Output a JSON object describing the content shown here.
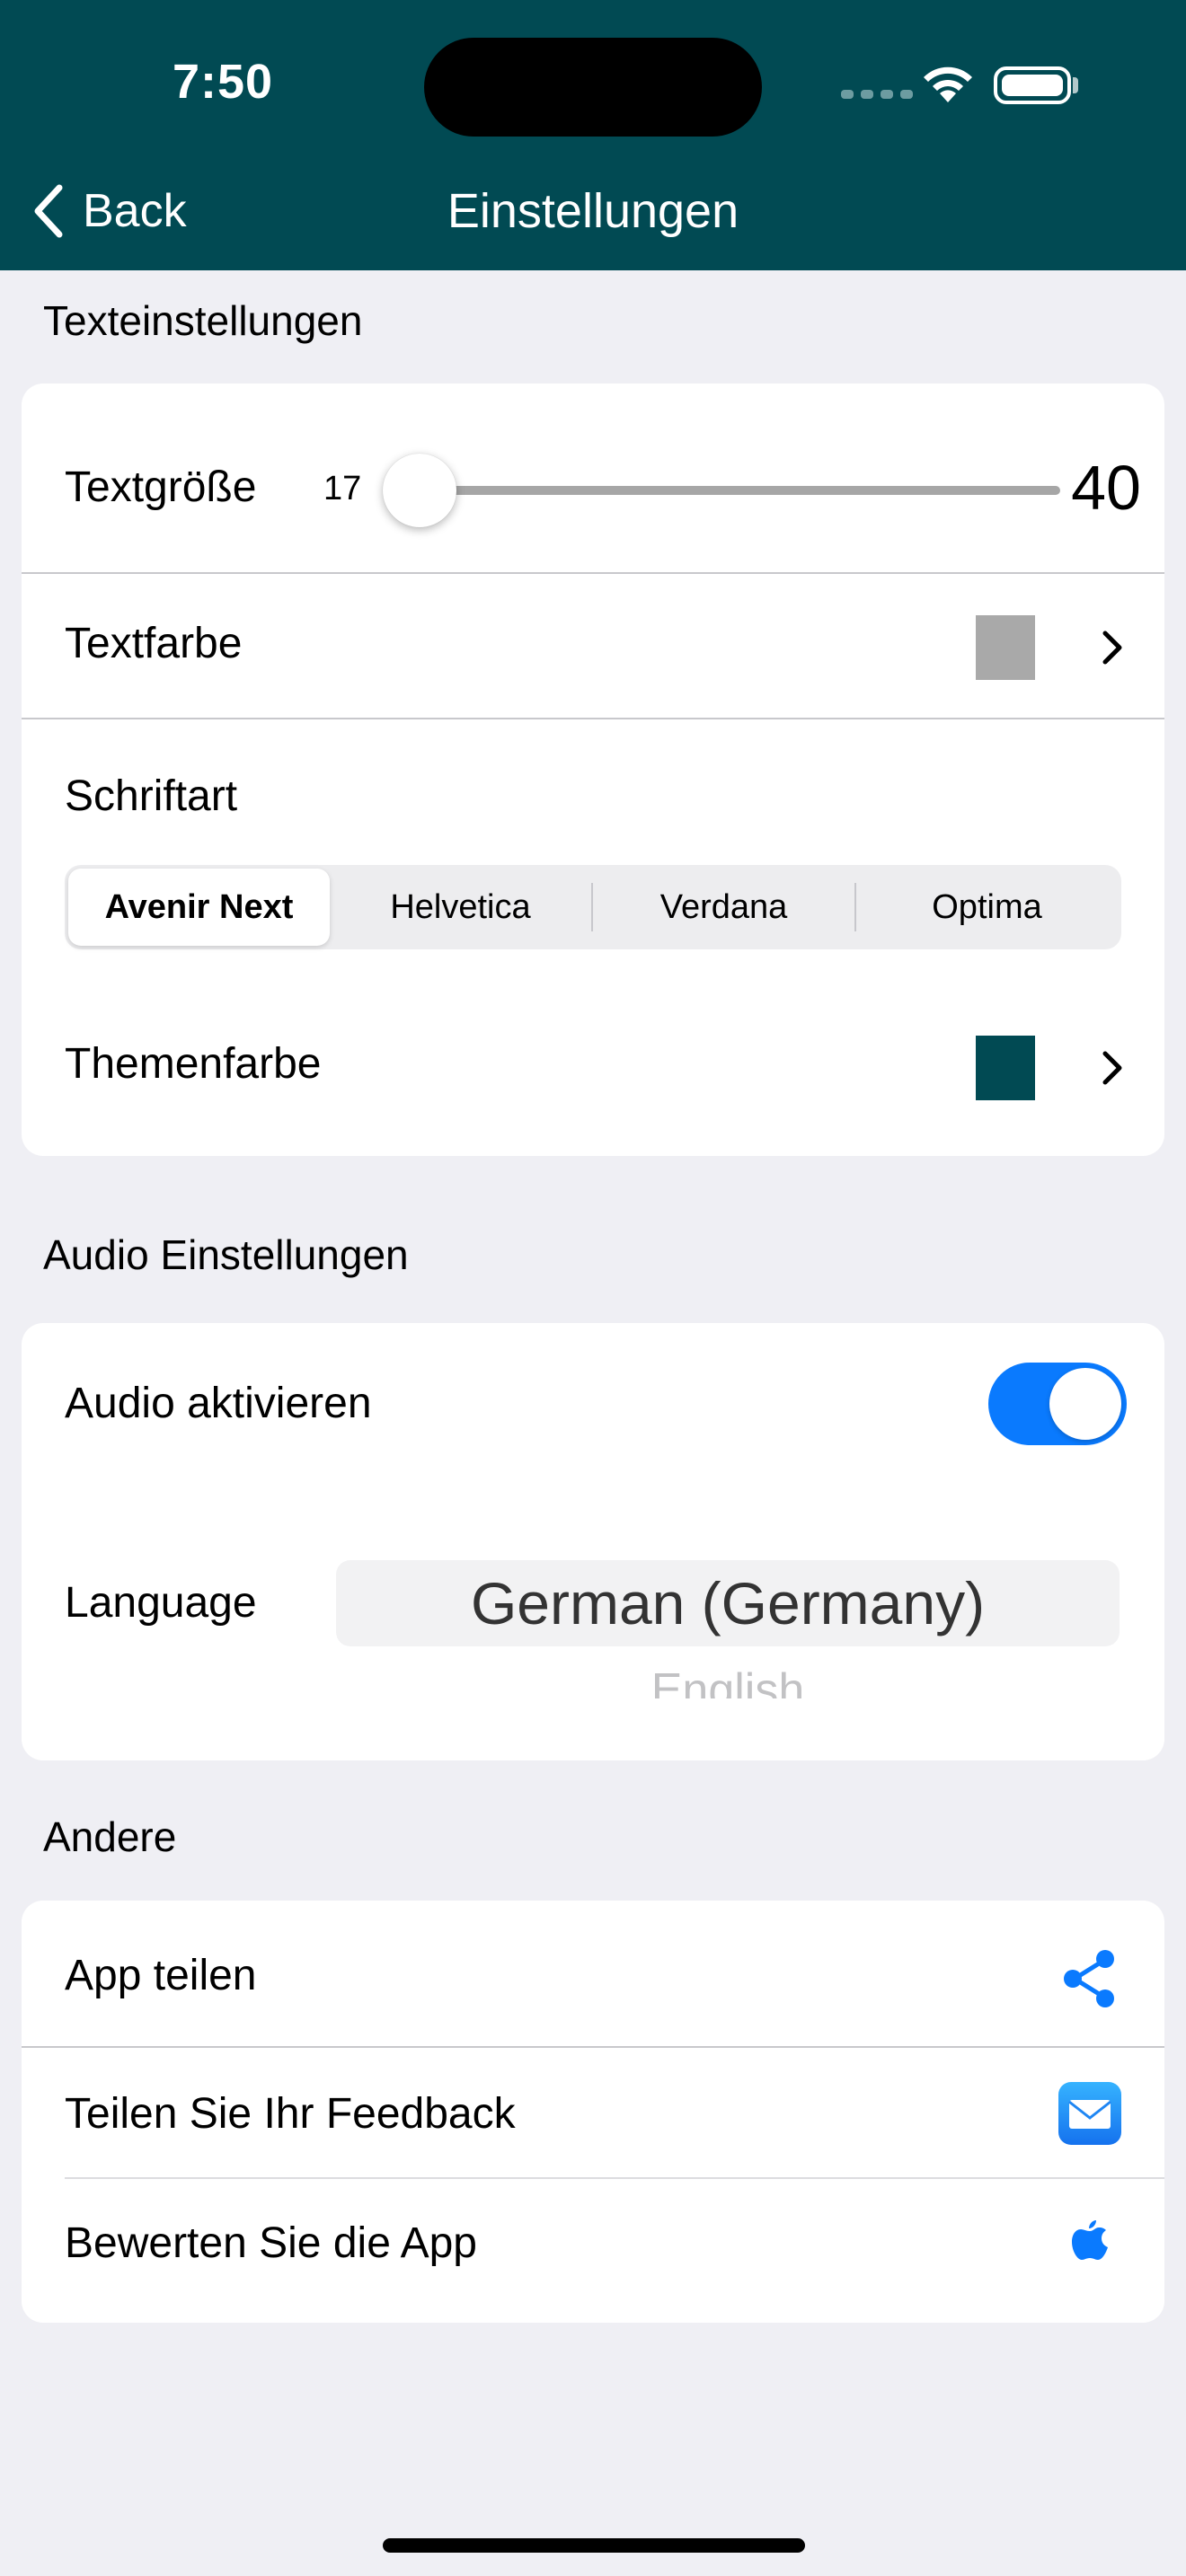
{
  "status_bar": {
    "time": "7:50"
  },
  "nav": {
    "back_label": "Back",
    "title": "Einstellungen"
  },
  "text_settings": {
    "section_label": "Texteinstellungen",
    "text_size": {
      "label": "Textgröße",
      "min": "17",
      "max": "40",
      "value": 17
    },
    "text_color": {
      "label": "Textfarbe",
      "swatch_color": "#a9a9a9"
    },
    "font": {
      "label": "Schriftart",
      "options": [
        "Avenir Next",
        "Helvetica",
        "Verdana",
        "Optima"
      ],
      "selected_index": 0
    },
    "theme_color": {
      "label": "Themenfarbe",
      "swatch_color": "#014a53"
    }
  },
  "audio_settings": {
    "section_label": "Audio Einstellungen",
    "enable_audio": {
      "label": "Audio aktivieren",
      "on": true
    },
    "language": {
      "label": "Language",
      "selected": "German (Germany)",
      "next": "English"
    }
  },
  "other": {
    "section_label": "Andere",
    "items": [
      {
        "label": "App teilen",
        "icon": "share-icon"
      },
      {
        "label": "Teilen Sie Ihr Feedback",
        "icon": "mail-icon"
      },
      {
        "label": "Bewerten Sie die App",
        "icon": "apple-icon"
      }
    ]
  },
  "colors": {
    "header": "#014a53",
    "accent": "#0a7afe",
    "background": "#efeff4"
  }
}
